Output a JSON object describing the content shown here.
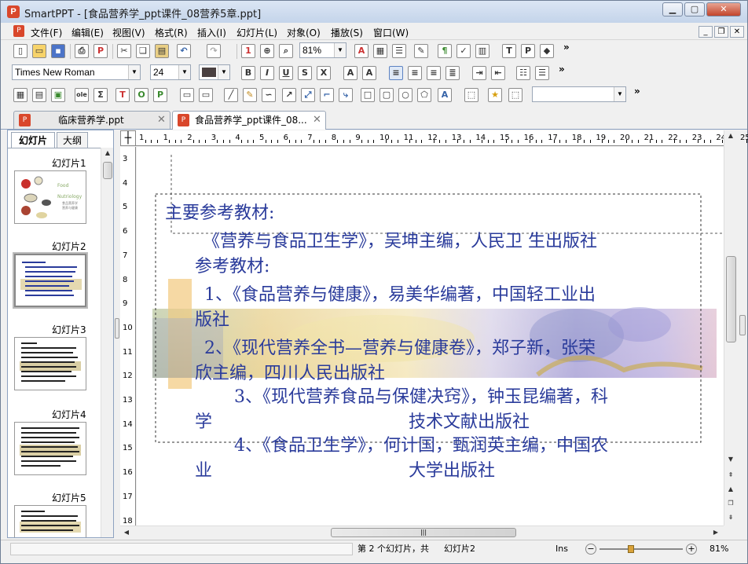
{
  "window": {
    "title": "SmartPPT - [食品营养学_ppt课件_08营养5章.ppt]",
    "app_icon": "P"
  },
  "menu": [
    "文件(F)",
    "编辑(E)",
    "视图(V)",
    "格式(R)",
    "插入(I)",
    "幻灯片(L)",
    "对象(O)",
    "播放(S)",
    "窗口(W)"
  ],
  "toolbar": {
    "zoom": "81%",
    "font_name": "Times New Roman",
    "font_size": "24",
    "icons": [
      "new-icon",
      "open-icon",
      "save-icon",
      "print-icon",
      "pdf-icon",
      "cut-icon",
      "copy-icon",
      "paste-icon",
      "undo-icon",
      "redo-icon"
    ]
  },
  "doc_tabs": [
    {
      "label": "临床营养学.ppt",
      "active": false
    },
    {
      "label": "食品营养学_ppt课件_08...",
      "active": true
    }
  ],
  "panel": {
    "tab_slides": "幻灯片",
    "tab_outline": "大纲",
    "slides": [
      "幻灯片1",
      "幻灯片2",
      "幻灯片3",
      "幻灯片4",
      "幻灯片5"
    ],
    "thumb1_text": [
      "Food",
      "Nutriology",
      "食品营养学",
      "营养与健康"
    ]
  },
  "rulers": {
    "h": [
      "1",
      "1",
      "2",
      "3",
      "4",
      "5",
      "6",
      "7",
      "8",
      "9",
      "10",
      "11",
      "12",
      "13",
      "14",
      "15",
      "16",
      "17",
      "18",
      "19",
      "20",
      "21",
      "22",
      "23",
      "24",
      "25"
    ],
    "v": [
      "3",
      "4",
      "5",
      "6",
      "7",
      "8",
      "9",
      "10",
      "11",
      "12",
      "13",
      "14",
      "15",
      "16",
      "17",
      "18"
    ]
  },
  "slide": {
    "lines": [
      "主要参考教材:",
      "《营养与食品卫生学》，吴坤主编，人民卫  生出版社",
      "参考教材:",
      "1、《食品营养与健康》，易美华编著，中国轻工业出",
      "版社",
      "2、《现代营养全书—营养与健康卷》，郑子新，张荣",
      "欣主编，四川人民出版社",
      "3、《现代营养食品与保健决窍》，钟玉昆编著，科",
      "学",
      "技术文献出版社",
      "4、《食品卫生学》，何计国，甄润英主编，中国农",
      "业",
      "大学出版社"
    ],
    "text_color": "#2a3b9b"
  },
  "status": {
    "slide_info": "第 2 个幻灯片，共",
    "slide_name": "幻灯片2",
    "mode": "Ins",
    "zoom": "81%"
  }
}
